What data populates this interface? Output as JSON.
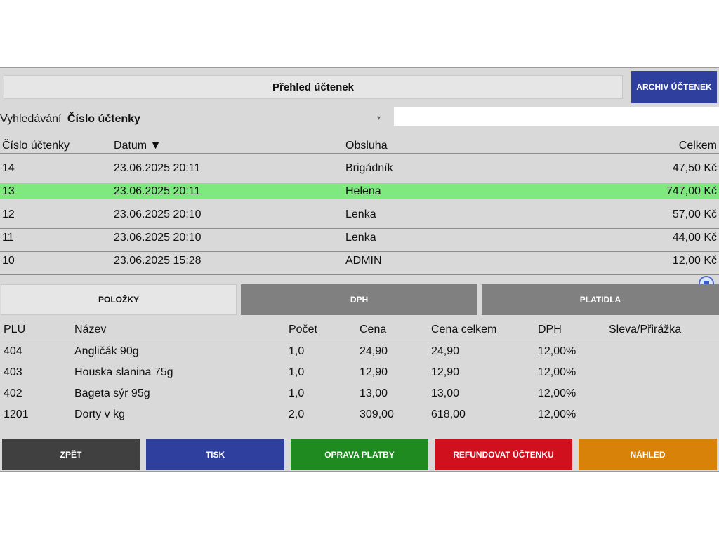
{
  "header": {
    "title": "Přehled účtenek",
    "archive_button": "ARCHIV ÚČTENEK"
  },
  "search": {
    "label": "Vyhledávání",
    "field": "Číslo účtenky",
    "value": ""
  },
  "receipts": {
    "columns": [
      "Číslo účtenky",
      "Datum ▼",
      "Obsluha",
      "Celkem"
    ],
    "rows": [
      [
        "14",
        "23.06.2025 20:11",
        "Brigádník",
        "47,50 Kč"
      ],
      [
        "13",
        "23.06.2025 20:11",
        "Helena",
        "747,00 Kč"
      ],
      [
        "12",
        "23.06.2025 20:10",
        "Lenka",
        "57,00 Kč"
      ],
      [
        "11",
        "23.06.2025 20:10",
        "Lenka",
        "44,00 Kč"
      ],
      [
        "10",
        "23.06.2025 15:28",
        "ADMIN",
        "12,00 Kč"
      ]
    ],
    "selected_row": "13"
  },
  "tabs": [
    "POLOŽKY",
    "DPH",
    "PLATIDLA"
  ],
  "active_tab": "POLOŽKY",
  "items": {
    "columns": [
      "PLU",
      "Název",
      "Počet",
      "Cena",
      "Cena celkem",
      "DPH",
      "Sleva/Přirážka"
    ],
    "rows": [
      [
        "404",
        "Angličák 90g",
        "1,0",
        "24,90",
        "24,90",
        "12,00%",
        ""
      ],
      [
        "403",
        "Houska slanina 75g",
        "1,0",
        "12,90",
        "12,90",
        "12,00%",
        ""
      ],
      [
        "402",
        "Bageta sýr 95g",
        "1,0",
        "13,00",
        "13,00",
        "12,00%",
        ""
      ],
      [
        "1201",
        "Dorty v kg",
        "2,0",
        "309,00",
        "618,00",
        "12,00%",
        ""
      ]
    ]
  },
  "buttons": [
    "ZPĚT",
    "TISK",
    "OPRAVA PLATBY",
    "REFUNDOVAT ÚČTENKU",
    "NÁHLED"
  ],
  "colors": {
    "selected_row": "#7fe87f",
    "archive": "#2f3f9e",
    "back": "#404040",
    "print": "#2f3f9e",
    "fix_payment": "#1f8a1f",
    "refund": "#d0101c",
    "preview": "#d9820a"
  },
  "icons": {
    "dropdown": "caret-down-icon",
    "floating": "document-icon"
  }
}
